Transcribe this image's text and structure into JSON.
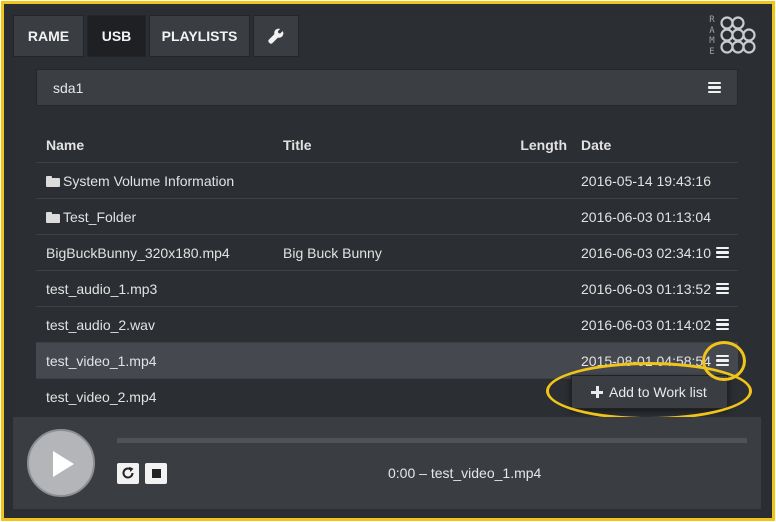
{
  "nav": {
    "tabs": [
      {
        "label": "RAME",
        "active": false
      },
      {
        "label": "USB",
        "active": true
      },
      {
        "label": "PLAYLISTS",
        "active": false
      },
      {
        "label": "",
        "icon": "wrench-icon",
        "active": false
      }
    ],
    "logo_text": "RAME"
  },
  "device": {
    "label": "sda1",
    "icon": "menu-icon"
  },
  "table": {
    "headers": {
      "name": "Name",
      "title": "Title",
      "length": "Length",
      "date": "Date"
    },
    "rows": [
      {
        "name": "System Volume Information",
        "title": "",
        "length": "",
        "date": "2016-05-14 19:43:16",
        "folder": true,
        "menu": false
      },
      {
        "name": "Test_Folder",
        "title": "",
        "length": "",
        "date": "2016-06-03 01:13:04",
        "folder": true,
        "menu": false
      },
      {
        "name": "BigBuckBunny_320x180.mp4",
        "title": "Big Buck Bunny",
        "length": "",
        "date": "2016-06-03 02:34:10",
        "folder": false,
        "menu": true
      },
      {
        "name": "test_audio_1.mp3",
        "title": "",
        "length": "",
        "date": "2016-06-03 01:13:52",
        "folder": false,
        "menu": true
      },
      {
        "name": "test_audio_2.wav",
        "title": "",
        "length": "",
        "date": "2016-06-03 01:14:02",
        "folder": false,
        "menu": true
      },
      {
        "name": "test_video_1.mp4",
        "title": "",
        "length": "",
        "date": "2015-08-01 04:58:54",
        "folder": false,
        "menu": true,
        "selected": true
      },
      {
        "name": "test_video_2.mp4",
        "title": "",
        "length": "",
        "date": "",
        "folder": false,
        "menu": false
      }
    ]
  },
  "popup": {
    "label": "Add to Work list",
    "icon": "plus-icon"
  },
  "player": {
    "now_playing": "0:00 – test_video_1.mp4",
    "progress": 0
  },
  "colors": {
    "highlight": "#f0c419",
    "background": "#2b2e32",
    "panel": "#3a3e43"
  }
}
